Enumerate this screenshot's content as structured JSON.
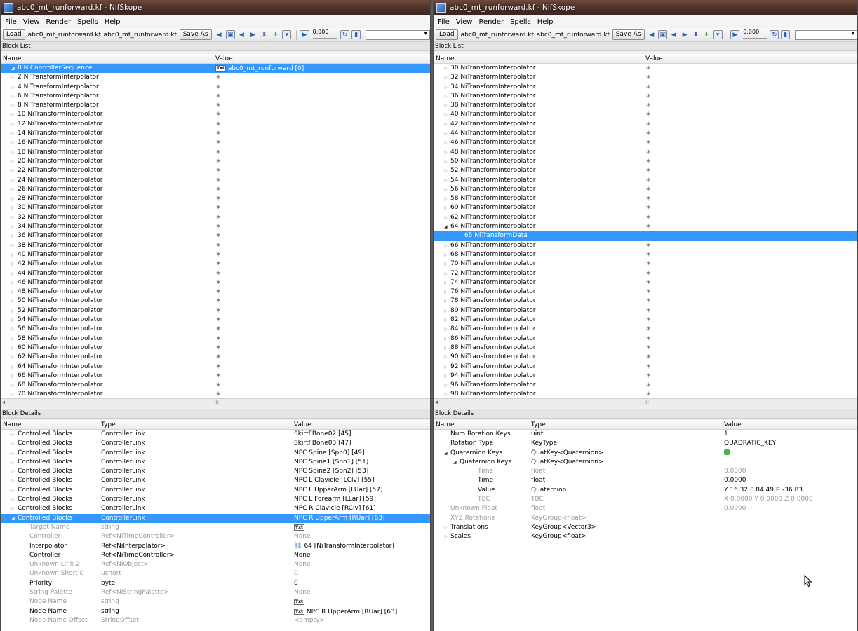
{
  "left": {
    "title": "abc0_mt_runforward.kf - NifSkope",
    "menu": [
      "File",
      "View",
      "Render",
      "Spells",
      "Help"
    ],
    "toolbar": {
      "load": "Load",
      "file1": "abc0_mt_runforward.kf",
      "file2": "abc0_mt_runforward.kf",
      "saveas": "Save As",
      "time": "0.000"
    },
    "block_list": {
      "label": "Block List",
      "col_name": "Name",
      "col_value": "Value",
      "rows": [
        {
          "name": "0 NiControllerSequence",
          "value": "abc0_mt_runforward [0]",
          "sel": true,
          "open": true,
          "txt": true
        },
        {
          "name": "2 NiTransformInterpolator"
        },
        {
          "name": "4 NiTransformInterpolator"
        },
        {
          "name": "6 NiTransformInterpolator"
        },
        {
          "name": "8 NiTransformInterpolator"
        },
        {
          "name": "10 NiTransformInterpolator"
        },
        {
          "name": "12 NiTransformInterpolator"
        },
        {
          "name": "14 NiTransformInterpolator"
        },
        {
          "name": "16 NiTransformInterpolator"
        },
        {
          "name": "18 NiTransformInterpolator"
        },
        {
          "name": "20 NiTransformInterpolator"
        },
        {
          "name": "22 NiTransformInterpolator"
        },
        {
          "name": "24 NiTransformInterpolator"
        },
        {
          "name": "26 NiTransformInterpolator"
        },
        {
          "name": "28 NiTransformInterpolator"
        },
        {
          "name": "30 NiTransformInterpolator"
        },
        {
          "name": "32 NiTransformInterpolator"
        },
        {
          "name": "34 NiTransformInterpolator"
        },
        {
          "name": "36 NiTransformInterpolator"
        },
        {
          "name": "38 NiTransformInterpolator"
        },
        {
          "name": "40 NiTransformInterpolator"
        },
        {
          "name": "42 NiTransformInterpolator"
        },
        {
          "name": "44 NiTransformInterpolator"
        },
        {
          "name": "46 NiTransformInterpolator"
        },
        {
          "name": "48 NiTransformInterpolator"
        },
        {
          "name": "50 NiTransformInterpolator"
        },
        {
          "name": "52 NiTransformInterpolator"
        },
        {
          "name": "54 NiTransformInterpolator"
        },
        {
          "name": "56 NiTransformInterpolator"
        },
        {
          "name": "58 NiTransformInterpolator"
        },
        {
          "name": "60 NiTransformInterpolator"
        },
        {
          "name": "62 NiTransformInterpolator"
        },
        {
          "name": "64 NiTransformInterpolator"
        },
        {
          "name": "66 NiTransformInterpolator"
        },
        {
          "name": "68 NiTransformInterpolator"
        },
        {
          "name": "70 NiTransformInterpolator"
        }
      ]
    },
    "block_details": {
      "label": "Block Details",
      "col_name": "Name",
      "col_type": "Type",
      "col_value": "Value",
      "rows": [
        {
          "name": "Controlled Blocks",
          "type": "ControllerLink",
          "value": "SkirtFBone02 [45]",
          "arrow": "closed"
        },
        {
          "name": "Controlled Blocks",
          "type": "ControllerLink",
          "value": "SkirtFBone03 [47]",
          "arrow": "closed"
        },
        {
          "name": "Controlled Blocks",
          "type": "ControllerLink",
          "value": "NPC Spine [Spn0] [49]",
          "arrow": "closed"
        },
        {
          "name": "Controlled Blocks",
          "type": "ControllerLink",
          "value": "NPC Spine1 [Spn1] [51]",
          "arrow": "closed"
        },
        {
          "name": "Controlled Blocks",
          "type": "ControllerLink",
          "value": "NPC Spine2 [Spn2] [53]",
          "arrow": "closed"
        },
        {
          "name": "Controlled Blocks",
          "type": "ControllerLink",
          "value": "NPC L Clavicle [LClv] [55]",
          "arrow": "closed"
        },
        {
          "name": "Controlled Blocks",
          "type": "ControllerLink",
          "value": "NPC L UpperArm [LUar] [57]",
          "arrow": "closed"
        },
        {
          "name": "Controlled Blocks",
          "type": "ControllerLink",
          "value": "NPC L Forearm [LLar] [59]",
          "arrow": "closed"
        },
        {
          "name": "Controlled Blocks",
          "type": "ControllerLink",
          "value": "NPC R Clavicle [RClv] [61]",
          "arrow": "closed"
        },
        {
          "name": "Controlled Blocks",
          "type": "ControllerLink",
          "value": "NPC R UpperArm [RUar] [63]",
          "arrow": "open",
          "sel": true
        },
        {
          "name": "Target Name",
          "type": "string",
          "value": "",
          "txt": true,
          "dim": true,
          "indent": 1
        },
        {
          "name": "Controller",
          "type": "Ref<NiTimeController>",
          "value": "None",
          "dim": true,
          "indent": 1
        },
        {
          "name": "Interpolator",
          "type": "Ref<NiInterpolator>",
          "value": "64 [NiTransformInterpolator]",
          "ref": true,
          "indent": 1
        },
        {
          "name": "Controller",
          "type": "Ref<NiTimeController>",
          "value": "None",
          "indent": 1
        },
        {
          "name": "Unknown Link 2",
          "type": "Ref<NiObject>",
          "value": "None",
          "dim": true,
          "indent": 1
        },
        {
          "name": "Unknown Short 0",
          "type": "ushort",
          "value": "0",
          "dim": true,
          "indent": 1
        },
        {
          "name": "Priority",
          "type": "byte",
          "value": "0",
          "indent": 1
        },
        {
          "name": "String Palette",
          "type": "Ref<NiStringPalette>",
          "value": "None",
          "dim": true,
          "indent": 1
        },
        {
          "name": "Node Name",
          "type": "string",
          "value": "",
          "txt": true,
          "dim": true,
          "indent": 1
        },
        {
          "name": "Node Name",
          "type": "string",
          "value": "NPC R UpperArm [RUar] [63]",
          "txt": true,
          "indent": 1
        },
        {
          "name": "Node Name Offset",
          "type": "StringOffset",
          "value": "<empty>",
          "dim": true,
          "indent": 1
        }
      ]
    }
  },
  "right": {
    "title": "abc0_mt_runforward.kf - NifSkope",
    "menu": [
      "File",
      "View",
      "Render",
      "Spells",
      "Help"
    ],
    "toolbar": {
      "load": "Load",
      "file1": "abc0_mt_runforward.kf",
      "file2": "abc0_mt_runforward.kf",
      "saveas": "Save As",
      "time": "0.000"
    },
    "block_list": {
      "label": "Block List",
      "col_name": "Name",
      "col_value": "Value",
      "rows": [
        {
          "name": "30 NiTransformInterpolator"
        },
        {
          "name": "32 NiTransformInterpolator"
        },
        {
          "name": "34 NiTransformInterpolator"
        },
        {
          "name": "36 NiTransformInterpolator"
        },
        {
          "name": "38 NiTransformInterpolator"
        },
        {
          "name": "40 NiTransformInterpolator"
        },
        {
          "name": "42 NiTransformInterpolator"
        },
        {
          "name": "44 NiTransformInterpolator"
        },
        {
          "name": "46 NiTransformInterpolator"
        },
        {
          "name": "48 NiTransformInterpolator"
        },
        {
          "name": "50 NiTransformInterpolator"
        },
        {
          "name": "52 NiTransformInterpolator"
        },
        {
          "name": "54 NiTransformInterpolator"
        },
        {
          "name": "56 NiTransformInterpolator"
        },
        {
          "name": "58 NiTransformInterpolator"
        },
        {
          "name": "60 NiTransformInterpolator"
        },
        {
          "name": "62 NiTransformInterpolator"
        },
        {
          "name": "64 NiTransformInterpolator",
          "open": true
        },
        {
          "name": "65 NiTransformData",
          "sel": true,
          "child": true
        },
        {
          "name": "66 NiTransformInterpolator"
        },
        {
          "name": "68 NiTransformInterpolator"
        },
        {
          "name": "70 NiTransformInterpolator"
        },
        {
          "name": "72 NiTransformInterpolator"
        },
        {
          "name": "74 NiTransformInterpolator"
        },
        {
          "name": "76 NiTransformInterpolator"
        },
        {
          "name": "78 NiTransformInterpolator"
        },
        {
          "name": "80 NiTransformInterpolator"
        },
        {
          "name": "82 NiTransformInterpolator"
        },
        {
          "name": "84 NiTransformInterpolator"
        },
        {
          "name": "86 NiTransformInterpolator"
        },
        {
          "name": "88 NiTransformInterpolator"
        },
        {
          "name": "90 NiTransformInterpolator"
        },
        {
          "name": "92 NiTransformInterpolator"
        },
        {
          "name": "94 NiTransformInterpolator"
        },
        {
          "name": "96 NiTransformInterpolator"
        },
        {
          "name": "98 NiTransformInterpolator"
        }
      ]
    },
    "block_details": {
      "label": "Block Details",
      "col_name": "Name",
      "col_type": "Type",
      "col_value": "Value",
      "rows": [
        {
          "name": "Num Rotation Keys",
          "type": "uint",
          "value": "1"
        },
        {
          "name": "Rotation Type",
          "type": "KeyType",
          "value": "QUADRATIC_KEY"
        },
        {
          "name": "Quaternion Keys",
          "type": "QuatKey<Quaternion>",
          "value": "",
          "green": true,
          "arrow": "open"
        },
        {
          "name": "Quaternion Keys",
          "type": "QuatKey<Quaternion>",
          "value": "",
          "arrow": "open",
          "indent": 1
        },
        {
          "name": "Time",
          "type": "float",
          "value": "0.0000",
          "dim": true,
          "indent": 2
        },
        {
          "name": "Time",
          "type": "float",
          "value": "0.0000",
          "indent": 2
        },
        {
          "name": "Value",
          "type": "Quaternion",
          "value": "Y 16.32 P 84.49 R -36.83",
          "indent": 2
        },
        {
          "name": "TBC",
          "type": "TBC",
          "value": "X 0.0000 Y 0.0000 Z 0.0000",
          "dim": true,
          "indent": 2
        },
        {
          "name": "Unknown Float",
          "type": "float",
          "value": "0.0000",
          "dim": true
        },
        {
          "name": "XYZ Rotations",
          "type": "KeyGroup<float>",
          "value": "",
          "dim": true
        },
        {
          "name": "Translations",
          "type": "KeyGroup<Vector3>",
          "value": "",
          "arrow": "closed"
        },
        {
          "name": "Scales",
          "type": "KeyGroup<float>",
          "value": "",
          "arrow": "closed"
        }
      ]
    }
  }
}
